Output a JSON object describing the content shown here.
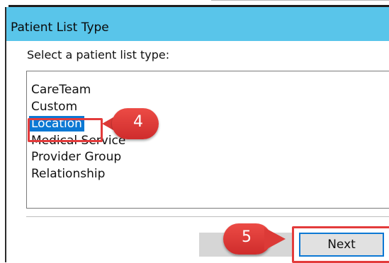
{
  "dialog": {
    "title": "Patient List Type",
    "prompt": "Select a patient list type:"
  },
  "list": {
    "items": [
      "CareTeam",
      "Custom",
      "Location",
      "Medical Service",
      "Provider Group",
      "Relationship"
    ],
    "selected": "Location"
  },
  "callouts": {
    "step4": "4",
    "step5": "5"
  },
  "buttons": {
    "next": "Next"
  },
  "colors": {
    "titlebar": "#59c5ea",
    "selection": "#0b78d4",
    "callout": "#e33b3b"
  }
}
